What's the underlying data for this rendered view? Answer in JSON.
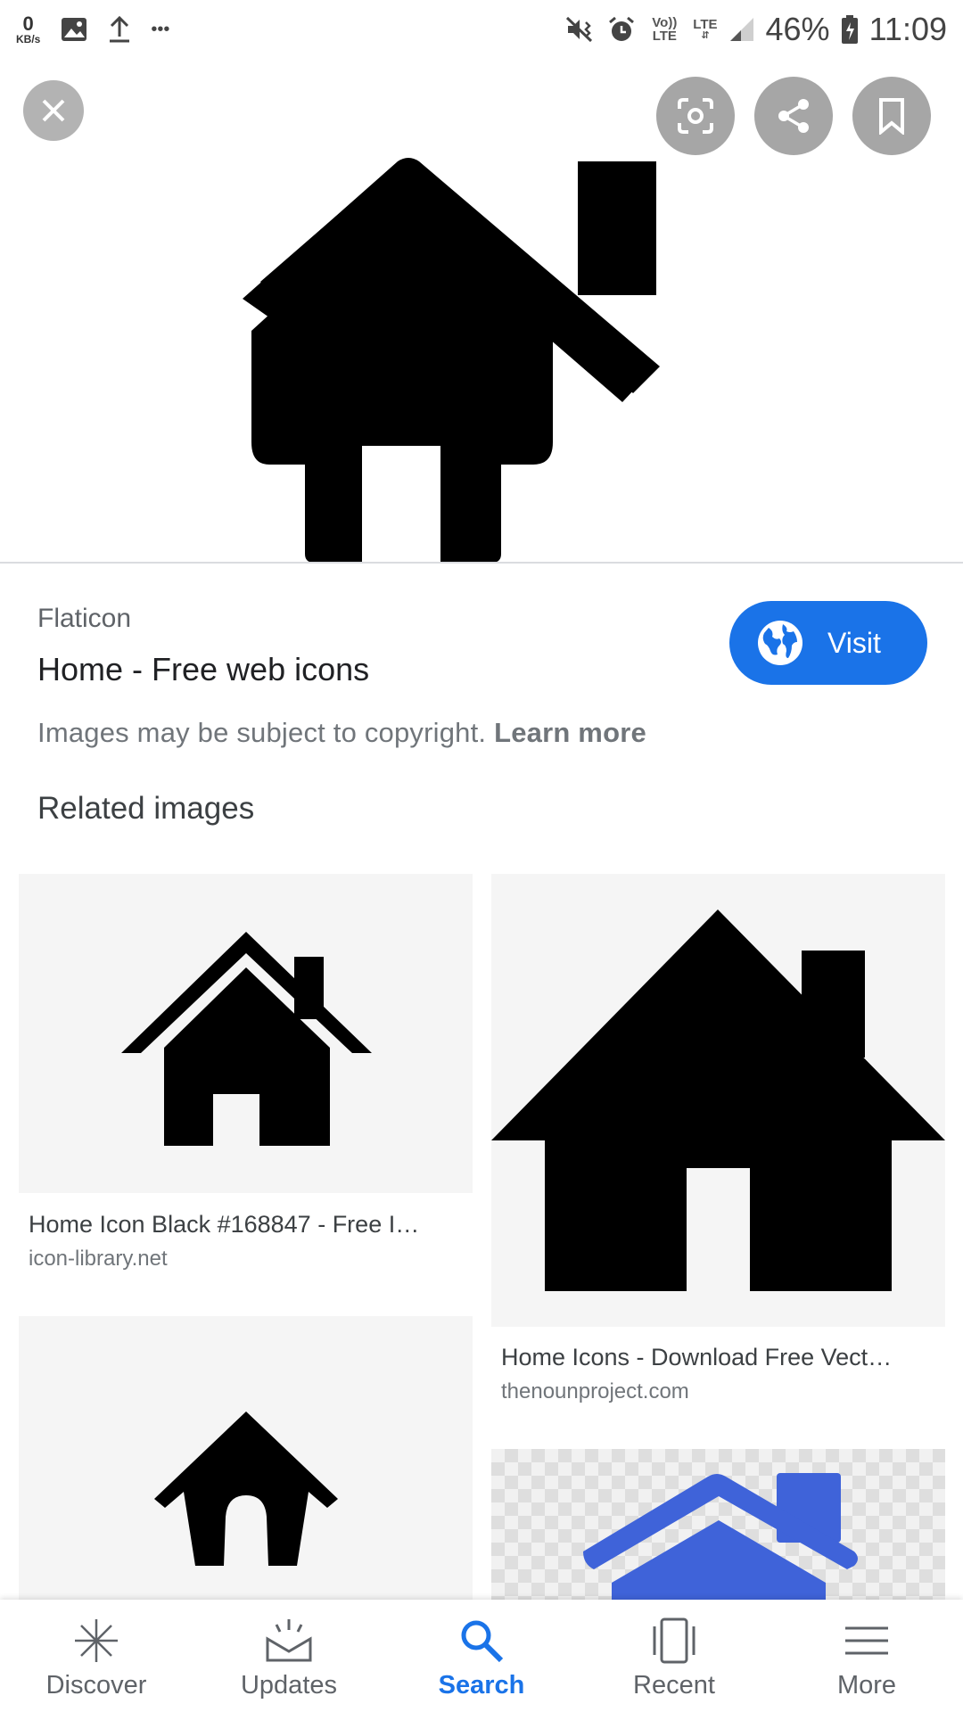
{
  "status_bar": {
    "net_speed_value": "0",
    "net_speed_unit": "KB/s",
    "more_dots": "•••",
    "volte": "Vo)) LTE",
    "lte": "LTE",
    "battery": "46%",
    "time": "11:09"
  },
  "result": {
    "source": "Flaticon",
    "title": "Home - Free web icons",
    "visit_label": "Visit",
    "copyright_text": "Images may be subject to copyright.",
    "learn_more": "Learn more"
  },
  "related": {
    "heading": "Related images",
    "items": [
      {
        "title": "Home Icon Black #168847 - Free I…",
        "domain": "icon-library.net"
      },
      {
        "title": "Home Icons - Download Free Vect…",
        "domain": "thenounproject.com"
      }
    ]
  },
  "nav": {
    "items": [
      {
        "label": "Discover",
        "icon": "discover-icon"
      },
      {
        "label": "Updates",
        "icon": "updates-icon"
      },
      {
        "label": "Search",
        "icon": "search-icon"
      },
      {
        "label": "Recent",
        "icon": "recent-icon"
      },
      {
        "label": "More",
        "icon": "menu-icon"
      }
    ],
    "active": "Search"
  },
  "colors": {
    "accent": "#1a73e8",
    "house_blue": "#3f63d9"
  }
}
